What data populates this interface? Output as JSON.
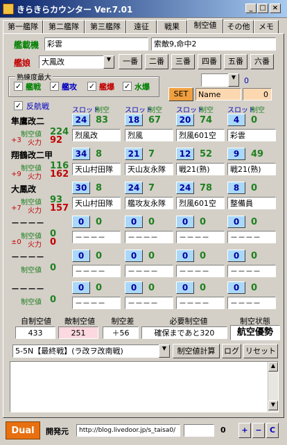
{
  "window": {
    "title": "きらきらカウンター Ver.7.01"
  },
  "tabs": [
    {
      "label": "第一艦隊"
    },
    {
      "label": "第二艦隊"
    },
    {
      "label": "第三艦隊"
    },
    {
      "label": "遠征"
    },
    {
      "label": "戦果"
    },
    {
      "label": "制空値"
    },
    {
      "label": "その他"
    },
    {
      "label": "メモ"
    }
  ],
  "header": {
    "admiral_label": "艦載機",
    "admiral_value": "彩雲",
    "admiral_right": "索敵9,命中2",
    "ship_label": "艦娘",
    "ship_value": "大鳳改",
    "fleet_buttons": [
      "一番",
      "二番",
      "三番",
      "四番",
      "五番",
      "六番"
    ]
  },
  "skill": {
    "legend": "熟練度最大",
    "items": [
      {
        "label": "艦戦",
        "color": "#008000"
      },
      {
        "label": "艦攻",
        "color": "#0000c0"
      },
      {
        "label": "艦爆",
        "color": "#c00000"
      },
      {
        "label": "水爆",
        "color": "#008000"
      }
    ],
    "small_value": "0"
  },
  "set": {
    "button": "SET",
    "name_value": "Name",
    "num_value": "0"
  },
  "counter_air": {
    "label": "反航戦"
  },
  "columns": {
    "slot": "スロット",
    "air": "制空"
  },
  "ship_labels": {
    "air": "制空値",
    "fire": "火力"
  },
  "ships": [
    {
      "name": "隼鷹改二",
      "air": "224",
      "bonus": "+3",
      "fire": "92",
      "slots": [
        {
          "n": "24",
          "v": "83",
          "eq": "烈風改"
        },
        {
          "n": "18",
          "v": "67",
          "eq": "烈風"
        },
        {
          "n": "20",
          "v": "74",
          "eq": "烈風601空"
        },
        {
          "n": "4",
          "v": "0",
          "eq": "彩雲"
        }
      ]
    },
    {
      "name": "翔鶴改二甲",
      "air": "116",
      "bonus": "+9",
      "fire": "162",
      "slots": [
        {
          "n": "34",
          "v": "8",
          "eq": "天山村田隊"
        },
        {
          "n": "21",
          "v": "7",
          "eq": "天山友永隊"
        },
        {
          "n": "12",
          "v": "52",
          "eq": "戦21(熟)"
        },
        {
          "n": "9",
          "v": "49",
          "eq": "戦21(熟)"
        }
      ]
    },
    {
      "name": "大鳳改",
      "air": "93",
      "bonus": "+7",
      "fire": "157",
      "slots": [
        {
          "n": "30",
          "v": "8",
          "eq": "天山村田隊"
        },
        {
          "n": "24",
          "v": "7",
          "eq": "艦攻友永隊"
        },
        {
          "n": "24",
          "v": "78",
          "eq": "烈風601空"
        },
        {
          "n": "8",
          "v": "0",
          "eq": "整備員"
        }
      ]
    },
    {
      "name": "－－－－",
      "air": "0",
      "bonus": "±0",
      "fire": "0",
      "slots": [
        {
          "n": "0",
          "v": "0",
          "eq": "－－－－"
        },
        {
          "n": "0",
          "v": "0",
          "eq": "－－－－"
        },
        {
          "n": "0",
          "v": "0",
          "eq": "－－－－"
        },
        {
          "n": "0",
          "v": "0",
          "eq": "－－－－"
        }
      ]
    },
    {
      "name": "－－－－",
      "air": "0",
      "bonus": "",
      "fire": "",
      "slots": [
        {
          "n": "0",
          "v": "0",
          "eq": "－－－－"
        },
        {
          "n": "0",
          "v": "0",
          "eq": "－－－－"
        },
        {
          "n": "0",
          "v": "0",
          "eq": "－－－－"
        },
        {
          "n": "0",
          "v": "0",
          "eq": "－－－－"
        }
      ]
    },
    {
      "name": "－－－－",
      "air": "0",
      "bonus": "",
      "fire": "",
      "slots": [
        {
          "n": "0",
          "v": "0",
          "eq": "－－－－"
        },
        {
          "n": "0",
          "v": "0",
          "eq": "－－－－"
        },
        {
          "n": "0",
          "v": "0",
          "eq": "－－－－"
        },
        {
          "n": "0",
          "v": "0",
          "eq": "－－－－"
        }
      ]
    }
  ],
  "summary": {
    "own_label": "自制空値",
    "own_value": "433",
    "enemy_label": "敵制空値",
    "enemy_value": "251",
    "diff_label": "制空差",
    "diff_value": "＋56",
    "need_label": "必要制空値",
    "need_value": "確保まであと320",
    "state_label": "制空状態",
    "state_value": "航空優勢"
  },
  "map": {
    "value": "5-5N【最終戦】(ラ改ヲ改南戦)",
    "calc": "制空値計算",
    "log": "ログ",
    "reset": "リセット"
  },
  "footer": {
    "dual": "Dual",
    "dev_label": "開発元",
    "url": "http://blog.livedoor.jp/s_taisa0/",
    "num": "0",
    "plus": "+",
    "minus": "−",
    "c": "C"
  }
}
